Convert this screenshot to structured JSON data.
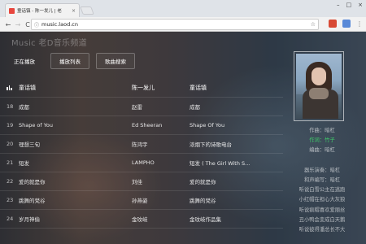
{
  "browser": {
    "tab_title": "童话镇 - 陈一发儿 | 老",
    "tab_close": "×",
    "url": "music.laod.cn",
    "back_icon": "←",
    "forward_icon": "→",
    "reload_icon": "C",
    "star_icon": "☆",
    "menu_icon": "⋮",
    "window_controls": [
      "–",
      "□",
      "×"
    ],
    "ext1_color": "#d84a35",
    "ext2_color": "#5a8ad8"
  },
  "site": {
    "title": "Music 老D音乐频道"
  },
  "modes": [
    {
      "label": "正在播放",
      "active": true
    },
    {
      "label": "播放列表",
      "active": false
    },
    {
      "label": "歌曲搜索",
      "active": false
    }
  ],
  "table": {
    "header": {
      "song": "童话镇",
      "artist": "陈一发儿",
      "album": "童话镇"
    },
    "rows": [
      {
        "num": "18",
        "song": "成都",
        "artist": "赵雷",
        "album": "成都"
      },
      {
        "num": "19",
        "song": "Shape of You",
        "artist": "Ed Sheeran",
        "album": "Shape Of You"
      },
      {
        "num": "20",
        "song": "理想三旬",
        "artist": "陈鸿宇",
        "album": "浓烟下的诗歌电台"
      },
      {
        "num": "21",
        "song": "短发",
        "artist": "LAMPHO",
        "album": "短发 ( The Girl With S..."
      },
      {
        "num": "22",
        "song": "爱的就是你",
        "artist": "刘佳",
        "album": "爱的就是你"
      },
      {
        "num": "23",
        "song": "跳舞的梵谷",
        "artist": "孙燕姿",
        "album": "跳舞的梵谷"
      },
      {
        "num": "24",
        "song": "岁月神偷",
        "artist": "金玟岐",
        "album": "金玟岐作品集"
      }
    ]
  },
  "lyrics": {
    "lines": [
      {
        "text": "作曲：暗杠",
        "current": false
      },
      {
        "text": "作词：竹子",
        "current": true
      },
      {
        "text": "编曲：暗杠",
        "current": false
      },
      {
        "text": "",
        "current": false
      },
      {
        "text": "器乐演奏：暗杠",
        "current": false
      },
      {
        "text": "和声编写：暗杠",
        "current": false
      },
      {
        "text": "听说白雪公主在逃跑",
        "current": false
      },
      {
        "text": "小红帽在担心大灰狼",
        "current": false
      },
      {
        "text": "听说疯帽喜欢爱丽丝",
        "current": false
      },
      {
        "text": "丑小鸭会变成白天鹅",
        "current": false
      },
      {
        "text": "听说彼得潘总长不大",
        "current": false
      }
    ]
  }
}
